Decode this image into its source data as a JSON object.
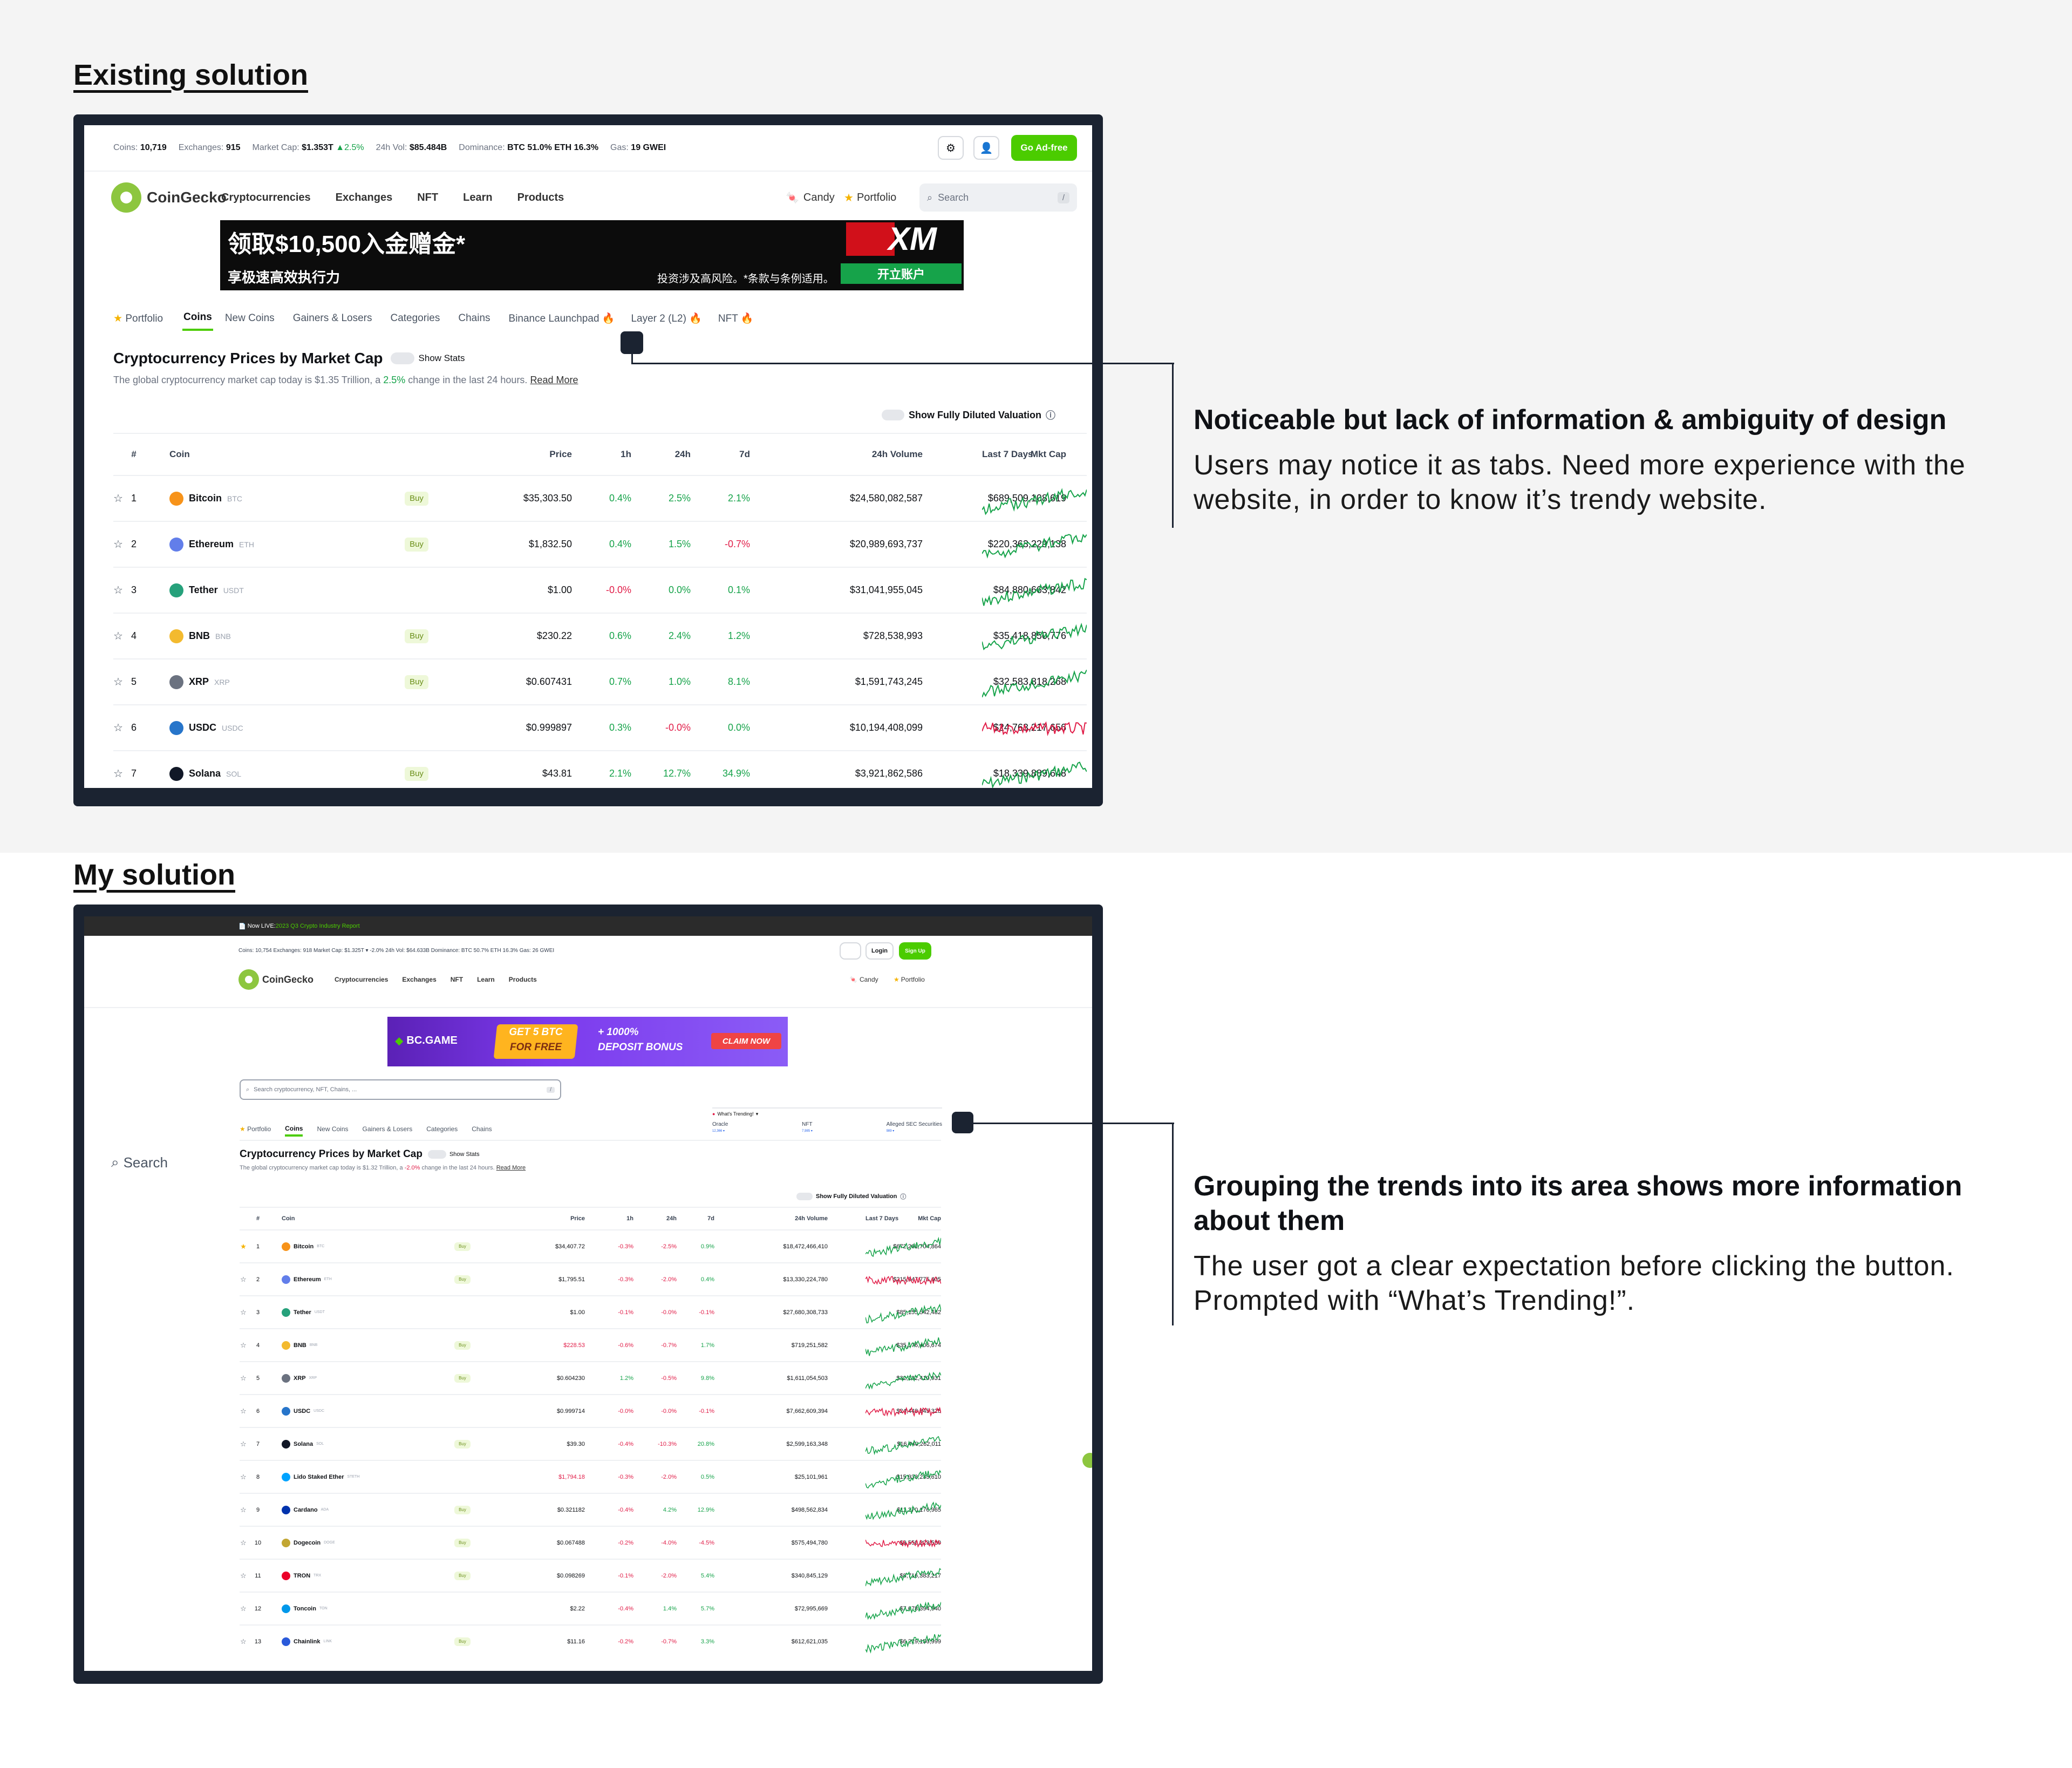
{
  "sections": {
    "existing_title": "Existing solution",
    "mine_title": "My solution"
  },
  "notes": {
    "existing": {
      "heading": "Noticeable but lack of information & ambiguity of design",
      "body": "Users may notice it as tabs. Need more experience with the website, in order to know it’s trendy website."
    },
    "mine": {
      "heading": "Grouping the trends into its area shows more information about them",
      "body": "The user got a clear expectation before clicking the button. Prompted with “What’s Trending!”."
    }
  },
  "existing": {
    "stats": {
      "coins_label": "Coins:",
      "coins": "10,719",
      "exchanges_label": "Exchanges:",
      "exchanges": "915",
      "mcap_label": "Market Cap:",
      "mcap": "$1.353T",
      "mcap_change": "▲2.5%",
      "vol_label": "24h Vol:",
      "vol": "$85.484B",
      "dom_label": "Dominance:",
      "dom": "BTC 51.0%  ETH 16.3%",
      "gas_label": "Gas:",
      "gas": "19 GWEI"
    },
    "go_ad_free": "Go Ad-free",
    "brand": "CoinGecko",
    "nav": [
      "Cryptocurrencies",
      "Exchanges",
      "NFT",
      "Learn",
      "Products"
    ],
    "candy": "Candy",
    "portfolio": "Portfolio",
    "search_placeholder": "Search",
    "search_key": "/",
    "ad": {
      "headline": "领取$10,500入金赠金*",
      "sub": "享极速高效执行力",
      "disclaimer": "投资涉及高风险。*条款与条例适用。",
      "brand": "XM",
      "cta": "开立账户"
    },
    "tabs": [
      "Portfolio",
      "Coins",
      "New Coins",
      "Gainers & Losers",
      "Categories",
      "Chains",
      "Binance Launchpad",
      "Layer 2 (L2)",
      "NFT"
    ],
    "page_title": "Cryptocurrency Prices by Market Cap",
    "show_stats": "Show Stats",
    "desc_a": "The global cryptocurrency market cap today is $1.35 Trillion, a ",
    "desc_change": "2.5%",
    "desc_b": " change in the last 24 hours. ",
    "read_more": "Read More",
    "fdv": "Show Fully Diluted Valuation",
    "columns": [
      "#",
      "Coin",
      "Price",
      "1h",
      "24h",
      "7d",
      "24h Volume",
      "Mkt Cap",
      "Last 7 Days"
    ],
    "rows": [
      {
        "rank": "1",
        "name": "Bitcoin",
        "sym": "BTC",
        "buy": "Buy",
        "price": "$35,303.50",
        "h1": "0.4%",
        "h24": "2.5%",
        "d7": "2.1%",
        "vol": "$24,580,082,587",
        "mcap": "$689,509,108,619",
        "color": "#f7931a",
        "trend": "g"
      },
      {
        "rank": "2",
        "name": "Ethereum",
        "sym": "ETH",
        "buy": "Buy",
        "price": "$1,832.50",
        "h1": "0.4%",
        "h24": "1.5%",
        "d7": "-0.7%",
        "vol": "$20,989,693,737",
        "mcap": "$220,363,229,138",
        "color": "#627eea",
        "trend": "g"
      },
      {
        "rank": "3",
        "name": "Tether",
        "sym": "USDT",
        "buy": "",
        "price": "$1.00",
        "h1": "-0.0%",
        "h24": "0.0%",
        "d7": "0.1%",
        "vol": "$31,041,955,045",
        "mcap": "$84,880,663,842",
        "color": "#26a17b",
        "trend": "g"
      },
      {
        "rank": "4",
        "name": "BNB",
        "sym": "BNB",
        "buy": "Buy",
        "price": "$230.22",
        "h1": "0.6%",
        "h24": "2.4%",
        "d7": "1.2%",
        "vol": "$728,538,993",
        "mcap": "$35,418,850,776",
        "color": "#f3ba2f",
        "trend": "g"
      },
      {
        "rank": "5",
        "name": "XRP",
        "sym": "XRP",
        "buy": "Buy",
        "price": "$0.607431",
        "h1": "0.7%",
        "h24": "1.0%",
        "d7": "8.1%",
        "vol": "$1,591,743,245",
        "mcap": "$32,583,818,268",
        "color": "#6b7280",
        "trend": "g"
      },
      {
        "rank": "6",
        "name": "USDC",
        "sym": "USDC",
        "buy": "",
        "price": "$0.999897",
        "h1": "0.3%",
        "h24": "-0.0%",
        "d7": "0.0%",
        "vol": "$10,194,408,099",
        "mcap": "$24,763,217,656",
        "color": "#2775ca",
        "trend": "r"
      },
      {
        "rank": "7",
        "name": "Solana",
        "sym": "SOL",
        "buy": "Buy",
        "price": "$43.81",
        "h1": "2.1%",
        "h24": "12.7%",
        "d7": "34.9%",
        "vol": "$3,921,862,586",
        "mcap": "$18,339,889,648",
        "color": "#111827",
        "trend": "g"
      }
    ]
  },
  "mine": {
    "banner_a": "Now LIVE: ",
    "banner_b": "2023 Q3 Crypto Industry Report",
    "stats": "Coins: 10,754   Exchanges: 918   Market Cap: $1.325T ▾ -2.0%   24h Vol: $64.633B   Dominance: BTC 50.7%  ETH 16.3%   Gas: 26 GWEI",
    "login": "Login",
    "signup": "Sign Up",
    "brand": "CoinGecko",
    "nav": [
      "Cryptocurrencies",
      "Exchanges",
      "NFT",
      "Learn",
      "Products"
    ],
    "candy": "Candy",
    "portfolio": "Portfolio",
    "ad": {
      "brand": "BC.GAME",
      "offer_a": "GET 5 BTC",
      "offer_b": "FOR FREE",
      "bonus_a": "+ 1000%",
      "bonus_b": "DEPOSIT BONUS",
      "cta": "CLAIM NOW"
    },
    "search_placeholder": "Search cryptocurrency, NFT, Chains, ...",
    "search_key": "/",
    "side_search": "Search",
    "trending": {
      "label": "What's Trending!",
      "items": [
        {
          "name": "Oracle",
          "value": "12,366 ▾"
        },
        {
          "name": "NFT",
          "value": "7,985 ▾"
        },
        {
          "name": "Alleged SEC Securities",
          "value": "989 ▾"
        }
      ]
    },
    "tabs": [
      "Portfolio",
      "Coins",
      "New Coins",
      "Gainers & Losers",
      "Categories",
      "Chains"
    ],
    "page_title": "Cryptocurrency Prices by Market Cap",
    "show_stats": "Show Stats",
    "desc_a": "The global cryptocurrency market cap today is $1.32 Trillion, a ",
    "desc_change": "-2.0%",
    "desc_b": "  change in the last 24 hours. ",
    "read_more": "Read More",
    "fdv": "Show Fully Diluted Valuation",
    "columns": [
      "#",
      "Coin",
      "Price",
      "1h",
      "24h",
      "7d",
      "24h Volume",
      "Mkt Cap",
      "Last 7 Days"
    ],
    "rows": [
      {
        "rank": "1",
        "name": "Bitcoin",
        "sym": "BTC",
        "buy": "Buy",
        "price": "$34,407.72",
        "pc": "",
        "h1": "-0.3%",
        "h24": "-2.5%",
        "d7": "0.9%",
        "vol": "$18,472,466,410",
        "mcap": "$672,261,704,864",
        "color": "#f7931a",
        "trend": "g",
        "fav": true
      },
      {
        "rank": "2",
        "name": "Ethereum",
        "sym": "ETH",
        "buy": "Buy",
        "price": "$1,795.51",
        "pc": "",
        "h1": "-0.3%",
        "h24": "-2.0%",
        "d7": "0.4%",
        "vol": "$13,330,224,780",
        "mcap": "$215,947,775,405",
        "color": "#627eea",
        "trend": "r",
        "fav": false
      },
      {
        "rank": "3",
        "name": "Tether",
        "sym": "USDT",
        "buy": "",
        "price": "$1.00",
        "pc": "",
        "h1": "-0.1%",
        "h24": "-0.0%",
        "d7": "-0.1%",
        "vol": "$27,680,308,733",
        "mcap": "$85,155,542,482",
        "color": "#26a17b",
        "trend": "g",
        "fav": false
      },
      {
        "rank": "4",
        "name": "BNB",
        "sym": "BNB",
        "buy": "Buy",
        "price": "$228.53",
        "pc": "r",
        "h1": "-0.6%",
        "h24": "-0.7%",
        "d7": "1.7%",
        "vol": "$719,251,582",
        "mcap": "$35,176,406,674",
        "color": "#f3ba2f",
        "trend": "g",
        "fav": false
      },
      {
        "rank": "5",
        "name": "XRP",
        "sym": "XRP",
        "buy": "Buy",
        "price": "$0.604230",
        "pc": "",
        "h1": "1.2%",
        "h24": "-0.5%",
        "d7": "9.8%",
        "vol": "$1,611,054,503",
        "mcap": "$32,132,410,931",
        "color": "#6b7280",
        "trend": "g",
        "fav": false
      },
      {
        "rank": "6",
        "name": "USDC",
        "sym": "USDC",
        "buy": "",
        "price": "$0.999714",
        "pc": "",
        "h1": "-0.0%",
        "h24": "-0.0%",
        "d7": "-0.1%",
        "vol": "$7,662,609,394",
        "mcap": "$24,448,845,325",
        "color": "#2775ca",
        "trend": "r",
        "fav": false
      },
      {
        "rank": "7",
        "name": "Solana",
        "sym": "SOL",
        "buy": "Buy",
        "price": "$39.30",
        "pc": "",
        "h1": "-0.4%",
        "h24": "-10.3%",
        "d7": "20.8%",
        "vol": "$2,599,163,348",
        "mcap": "$16,440,262,011",
        "color": "#111827",
        "trend": "g",
        "fav": false
      },
      {
        "rank": "8",
        "name": "Lido Staked Ether",
        "sym": "STETH",
        "buy": "",
        "price": "$1,794.18",
        "pc": "r",
        "h1": "-0.3%",
        "h24": "-2.0%",
        "d7": "0.5%",
        "vol": "$25,101,961",
        "mcap": "$15,933,233,610",
        "color": "#00a3ff",
        "trend": "g",
        "fav": false
      },
      {
        "rank": "9",
        "name": "Cardano",
        "sym": "ADA",
        "buy": "Buy",
        "price": "$0.321182",
        "pc": "",
        "h1": "-0.4%",
        "h24": "4.2%",
        "d7": "12.9%",
        "vol": "$498,562,834",
        "mcap": "$11,270,176,965",
        "color": "#0033ad",
        "trend": "g",
        "fav": false
      },
      {
        "rank": "10",
        "name": "Dogecoin",
        "sym": "DOGE",
        "buy": "Buy",
        "price": "$0.067488",
        "pc": "",
        "h1": "-0.2%",
        "h24": "-4.0%",
        "d7": "-4.5%",
        "vol": "$575,494,780",
        "mcap": "$9,550,223,580",
        "color": "#c2a633",
        "trend": "r",
        "fav": false
      },
      {
        "rank": "11",
        "name": "TRON",
        "sym": "TRX",
        "buy": "Buy",
        "price": "$0.098269",
        "pc": "",
        "h1": "-0.1%",
        "h24": "-2.0%",
        "d7": "5.4%",
        "vol": "$340,845,129",
        "mcap": "$8,716,383,217",
        "color": "#eb0029",
        "trend": "g",
        "fav": false
      },
      {
        "rank": "12",
        "name": "Toncoin",
        "sym": "TON",
        "buy": "",
        "price": "$2.22",
        "pc": "",
        "h1": "-0.4%",
        "h24": "1.4%",
        "d7": "5.7%",
        "vol": "$72,995,669",
        "mcap": "$7,678,394,940",
        "color": "#0098ea",
        "trend": "g",
        "fav": false
      },
      {
        "rank": "13",
        "name": "Chainlink",
        "sym": "LINK",
        "buy": "Buy",
        "price": "$11.16",
        "pc": "",
        "h1": "-0.2%",
        "h24": "-0.7%",
        "d7": "3.3%",
        "vol": "$612,621,035",
        "mcap": "$6,219,150,999",
        "color": "#2a5ada",
        "trend": "g",
        "fav": false
      }
    ]
  }
}
